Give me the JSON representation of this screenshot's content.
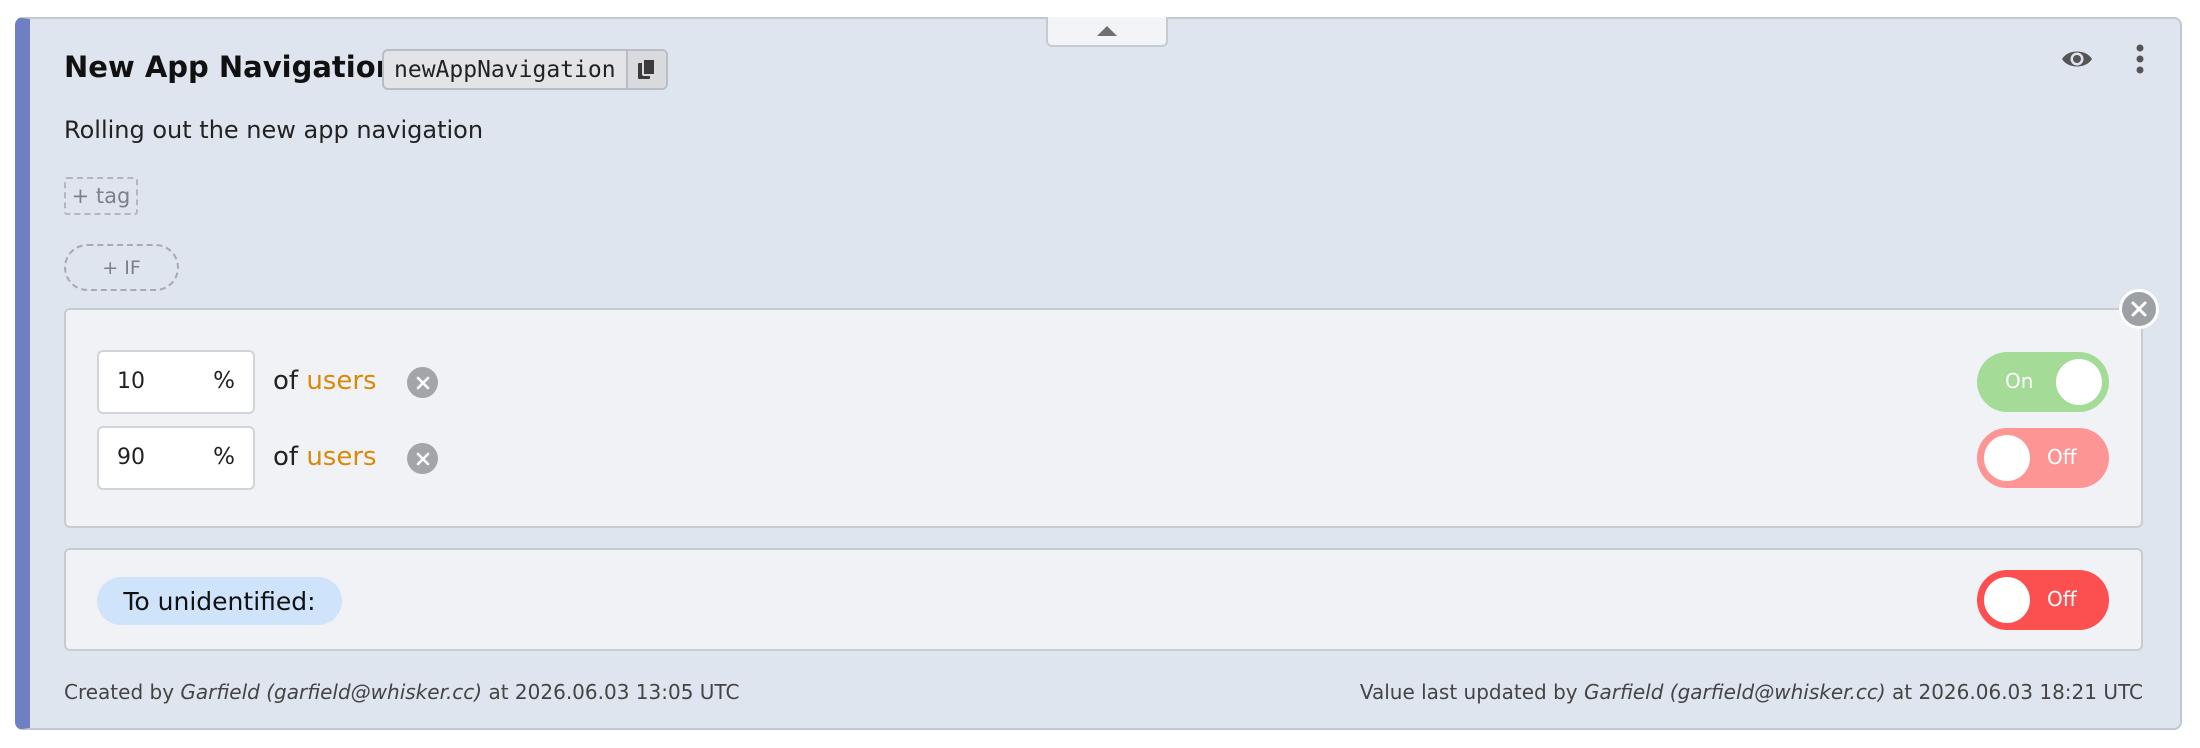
{
  "flag": {
    "title": "New App Navigation",
    "key": "newAppNavigation",
    "description": "Rolling out the new app navigation"
  },
  "actions": {
    "add_tag_label": "+ tag",
    "add_if_label": "+ IF"
  },
  "rules": [
    {
      "percent": "10",
      "percent_sign": "%",
      "of_label": "of",
      "segment": "users",
      "toggle_label": "On",
      "state": "on"
    },
    {
      "percent": "90",
      "percent_sign": "%",
      "of_label": "of",
      "segment": "users",
      "toggle_label": "Off",
      "state": "off"
    }
  ],
  "unidentified": {
    "label": "To unidentified:",
    "toggle_label": "Off",
    "state": "off"
  },
  "footer": {
    "created_prefix": "Created by",
    "created_by": "Garfield (garfield@whisker.cc)",
    "created_at": "at 2026.06.03 13:05 UTC",
    "updated_prefix": "Value last updated by",
    "updated_by": "Garfield (garfield@whisker.cc)",
    "updated_at": "at 2026.06.03 18:21 UTC"
  },
  "colors": {
    "accent": "#6f7fc4",
    "segment": "#d88a0a",
    "on": "#a4dc97",
    "off_light": "#fd9595",
    "off": "#fc5050"
  },
  "icons": [
    "chevron-up-icon",
    "copy-icon",
    "eye-icon",
    "more-vertical-icon",
    "close-icon"
  ]
}
